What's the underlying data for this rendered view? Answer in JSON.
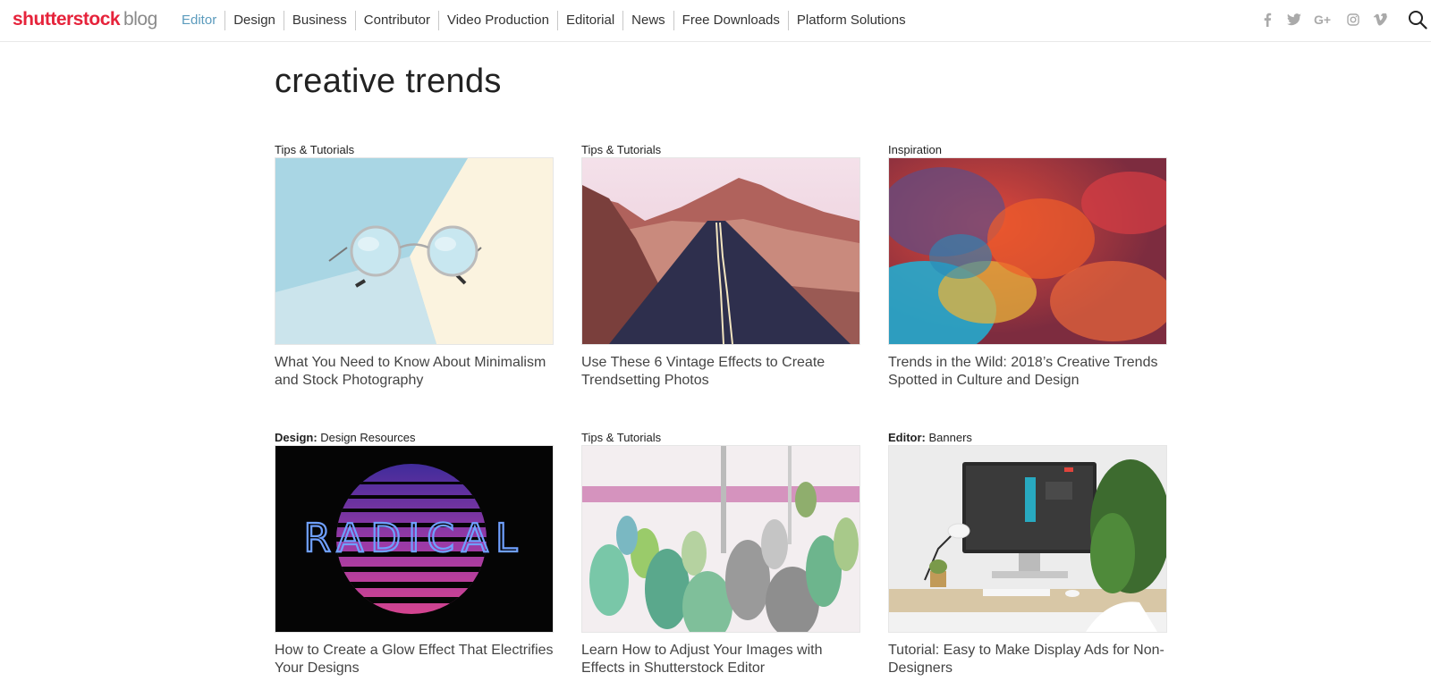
{
  "header": {
    "logo_brand_pre": "shutterst",
    "logo_brand_o": "o",
    "logo_brand_post": "ck",
    "logo_blog": "blog",
    "nav": [
      "Editor",
      "Design",
      "Business",
      "Contributor",
      "Video Production",
      "Editorial",
      "News",
      "Free Downloads",
      "Platform Solutions"
    ],
    "active_nav": "Editor",
    "social_icons": [
      "facebook-icon",
      "twitter-icon",
      "google-plus-icon",
      "instagram-icon",
      "vimeo-icon"
    ],
    "search_icon": "search-icon"
  },
  "page": {
    "title": "creative trends"
  },
  "cards": [
    {
      "category_bold": "",
      "category": "Tips & Tutorials",
      "image": "round sunglasses on pastel blue and cream background",
      "title": "What You Need to Know About Minimalism and Stock Photography"
    },
    {
      "category_bold": "",
      "category": "Tips & Tutorials",
      "image": "desert road leading to mountains",
      "title": "Use These 6 Vintage Effects to Create Trendsetting Photos"
    },
    {
      "category_bold": "",
      "category": "Inspiration",
      "image": "colorful abstract ink cloud",
      "title": "Trends in the Wild: 2018’s Creative Trends Spotted in Culture and Design"
    },
    {
      "category_bold": "Design:",
      "category": "Design Resources",
      "image_text": "RADICAL",
      "title": "How to Create a Glow Effect That Electrifies Your Designs"
    },
    {
      "category_bold": "",
      "category": "Tips & Tutorials",
      "image": "cactus plants with color effect",
      "title": "Learn How to Adjust Your Images with Effects in Shutterstock Editor"
    },
    {
      "category_bold": "Editor:",
      "category": "Banners",
      "image": "desk with monitor, lamp and plant",
      "title": "Tutorial: Easy to Make Display Ads for Non-Designers"
    }
  ],
  "colors": {
    "brand_red": "#e6233b",
    "active_nav": "#5b9bbd"
  }
}
